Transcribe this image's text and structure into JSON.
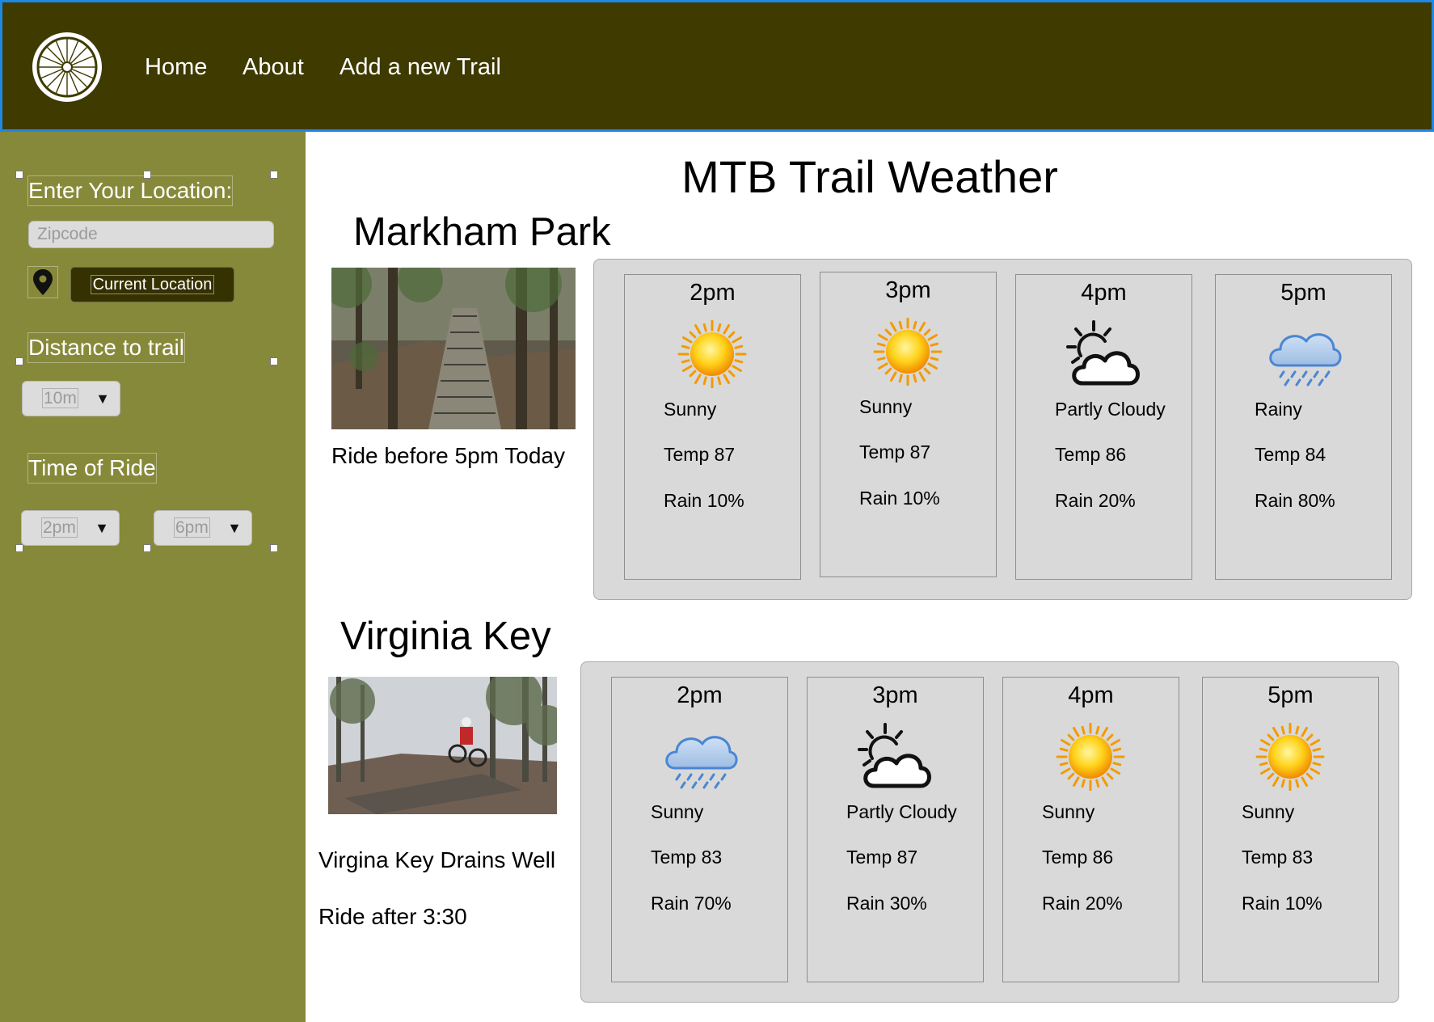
{
  "nav": [
    "Home",
    "About",
    "Add a new Trail"
  ],
  "sidebar": {
    "location_label": "Enter Your Location:",
    "zip_placeholder": "Zipcode",
    "current_location": "Current Location",
    "distance_label": "Distance to trail",
    "distance_value": "10m",
    "time_label": "Time of Ride",
    "time_from": "2pm",
    "time_to": "6pm"
  },
  "title": "MTB Trail Weather",
  "trails": [
    {
      "name": "Markham Park",
      "notes": [
        "Ride before 5pm Today"
      ],
      "forecast": [
        {
          "time": "2pm",
          "icon": "sun-icon",
          "cond": "Sunny",
          "temp": "Temp  87",
          "rain": "Rain  10%"
        },
        {
          "time": "3pm",
          "icon": "sun-icon",
          "cond": "Sunny",
          "temp": "Temp  87",
          "rain": "Rain  10%"
        },
        {
          "time": "4pm",
          "icon": "partly-cloudy-icon",
          "cond": "Partly Cloudy",
          "temp": "Temp  86",
          "rain": "Rain  20%"
        },
        {
          "time": "5pm",
          "icon": "rain-cloud-icon",
          "cond": "Rainy",
          "temp": "Temp  84",
          "rain": "Rain  80%"
        }
      ]
    },
    {
      "name": "Virginia Key",
      "notes": [
        "Virgina Key Drains Well",
        "Ride after 3:30"
      ],
      "forecast": [
        {
          "time": "2pm",
          "icon": "rain-cloud-icon",
          "cond": "Sunny",
          "temp": "Temp  83",
          "rain": "Rain  70%"
        },
        {
          "time": "3pm",
          "icon": "partly-cloudy-icon",
          "cond": "Partly Cloudy",
          "temp": "Temp  87",
          "rain": "Rain  30%"
        },
        {
          "time": "4pm",
          "icon": "sun-icon",
          "cond": "Sunny",
          "temp": "Temp  86",
          "rain": "Rain  20%"
        },
        {
          "time": "5pm",
          "icon": "sun-icon",
          "cond": "Sunny",
          "temp": "Temp  83",
          "rain": "Rain  10%"
        }
      ]
    }
  ],
  "colors": {
    "header_bg": "#3f3a00",
    "header_border": "#1e88e5",
    "sidebar_bg": "#87893a",
    "card_bg": "#d9d9d9",
    "rain_blue": "#4a86d4",
    "sun_orange": "#f9a300"
  }
}
